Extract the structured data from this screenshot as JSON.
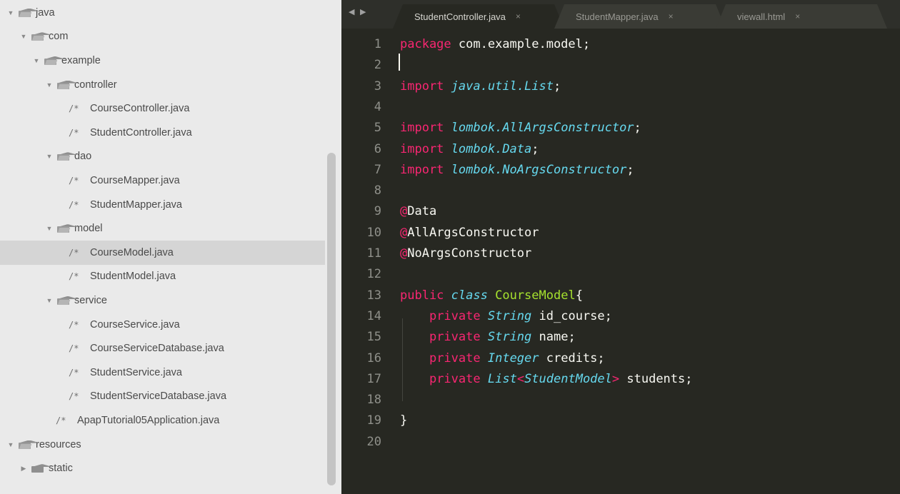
{
  "sidebar": {
    "tree": [
      {
        "label": "java",
        "type": "folder",
        "open": true,
        "depth": 0
      },
      {
        "label": "com",
        "type": "folder",
        "open": true,
        "depth": 1
      },
      {
        "label": "example",
        "type": "folder",
        "open": true,
        "depth": 2
      },
      {
        "label": "controller",
        "type": "folder",
        "open": true,
        "depth": 3
      },
      {
        "label": "CourseController.java",
        "type": "file",
        "depth": 4
      },
      {
        "label": "StudentController.java",
        "type": "file",
        "depth": 4
      },
      {
        "label": "dao",
        "type": "folder",
        "open": true,
        "depth": 3
      },
      {
        "label": "CourseMapper.java",
        "type": "file",
        "depth": 4
      },
      {
        "label": "StudentMapper.java",
        "type": "file",
        "depth": 4
      },
      {
        "label": "model",
        "type": "folder",
        "open": true,
        "depth": 3
      },
      {
        "label": "CourseModel.java",
        "type": "file",
        "depth": 4,
        "selected": true
      },
      {
        "label": "StudentModel.java",
        "type": "file",
        "depth": 4
      },
      {
        "label": "service",
        "type": "folder",
        "open": true,
        "depth": 3
      },
      {
        "label": "CourseService.java",
        "type": "file",
        "depth": 4
      },
      {
        "label": "CourseServiceDatabase.java",
        "type": "file",
        "depth": 4
      },
      {
        "label": "StudentService.java",
        "type": "file",
        "depth": 4
      },
      {
        "label": "StudentServiceDatabase.java",
        "type": "file",
        "depth": 4
      },
      {
        "label": "ApapTutorial05Application.java",
        "type": "file",
        "depth": 3
      },
      {
        "label": "resources",
        "type": "folder",
        "open": true,
        "depth": 0
      },
      {
        "label": "static",
        "type": "folder",
        "open": false,
        "depth": 1
      }
    ],
    "file_icon_glyph": "/*"
  },
  "tabs": [
    {
      "label": "StudentController.java",
      "close": "×",
      "active": true
    },
    {
      "label": "StudentMapper.java",
      "close": "×",
      "active": false
    },
    {
      "label": "viewall.html",
      "close": "×",
      "active": false
    }
  ],
  "nav_arrows": "◀ ▶",
  "editor": {
    "lines": [
      {
        "n": "1",
        "tokens": [
          [
            "k",
            "package"
          ],
          [
            "w",
            " com.example.model;"
          ]
        ]
      },
      {
        "n": "2",
        "tokens": []
      },
      {
        "n": "3",
        "tokens": [
          [
            "k",
            "import"
          ],
          [
            "w",
            " "
          ],
          [
            "t",
            "java.util.List"
          ],
          [
            "w",
            ";"
          ]
        ]
      },
      {
        "n": "4",
        "tokens": []
      },
      {
        "n": "5",
        "tokens": [
          [
            "k",
            "import"
          ],
          [
            "w",
            " "
          ],
          [
            "t",
            "lombok.AllArgsConstructor"
          ],
          [
            "w",
            ";"
          ]
        ]
      },
      {
        "n": "6",
        "tokens": [
          [
            "k",
            "import"
          ],
          [
            "w",
            " "
          ],
          [
            "t",
            "lombok.Data"
          ],
          [
            "w",
            ";"
          ]
        ]
      },
      {
        "n": "7",
        "tokens": [
          [
            "k",
            "import"
          ],
          [
            "w",
            " "
          ],
          [
            "t",
            "lombok.NoArgsConstructor"
          ],
          [
            "w",
            ";"
          ]
        ]
      },
      {
        "n": "8",
        "tokens": []
      },
      {
        "n": "9",
        "tokens": [
          [
            "k",
            "@"
          ],
          [
            "w",
            "Data"
          ]
        ]
      },
      {
        "n": "10",
        "tokens": [
          [
            "k",
            "@"
          ],
          [
            "w",
            "AllArgsConstructor"
          ]
        ]
      },
      {
        "n": "11",
        "tokens": [
          [
            "k",
            "@"
          ],
          [
            "w",
            "NoArgsConstructor"
          ]
        ]
      },
      {
        "n": "12",
        "tokens": []
      },
      {
        "n": "13",
        "tokens": [
          [
            "k",
            "public"
          ],
          [
            "w",
            " "
          ],
          [
            "t",
            "class"
          ],
          [
            "w",
            " "
          ],
          [
            "c",
            "CourseModel"
          ],
          [
            "w",
            "{"
          ]
        ]
      },
      {
        "n": "14",
        "tokens": [
          [
            "w",
            "    "
          ],
          [
            "k",
            "private"
          ],
          [
            "w",
            " "
          ],
          [
            "t",
            "String"
          ],
          [
            "w",
            " id_course;"
          ]
        ]
      },
      {
        "n": "15",
        "tokens": [
          [
            "w",
            "    "
          ],
          [
            "k",
            "private"
          ],
          [
            "w",
            " "
          ],
          [
            "t",
            "String"
          ],
          [
            "w",
            " name;"
          ]
        ]
      },
      {
        "n": "16",
        "tokens": [
          [
            "w",
            "    "
          ],
          [
            "k",
            "private"
          ],
          [
            "w",
            " "
          ],
          [
            "t",
            "Integer"
          ],
          [
            "w",
            " credits;"
          ]
        ]
      },
      {
        "n": "17",
        "tokens": [
          [
            "w",
            "    "
          ],
          [
            "k",
            "private"
          ],
          [
            "w",
            " "
          ],
          [
            "t",
            "List"
          ],
          [
            "k",
            "<"
          ],
          [
            "t",
            "StudentModel"
          ],
          [
            "k",
            ">"
          ],
          [
            "w",
            " students;"
          ]
        ]
      },
      {
        "n": "18",
        "tokens": []
      },
      {
        "n": "19",
        "tokens": [
          [
            "w",
            "}"
          ]
        ]
      },
      {
        "n": "20",
        "tokens": []
      }
    ]
  },
  "colors": {
    "editor_bg": "#272822",
    "keyword": "#f92672",
    "type": "#66d9ef",
    "class_name": "#a6e22e",
    "text": "#f8f8f2",
    "gutter": "#8f908a",
    "sidebar_bg": "#eaeaea",
    "selected_row": "#d5d5d5"
  }
}
